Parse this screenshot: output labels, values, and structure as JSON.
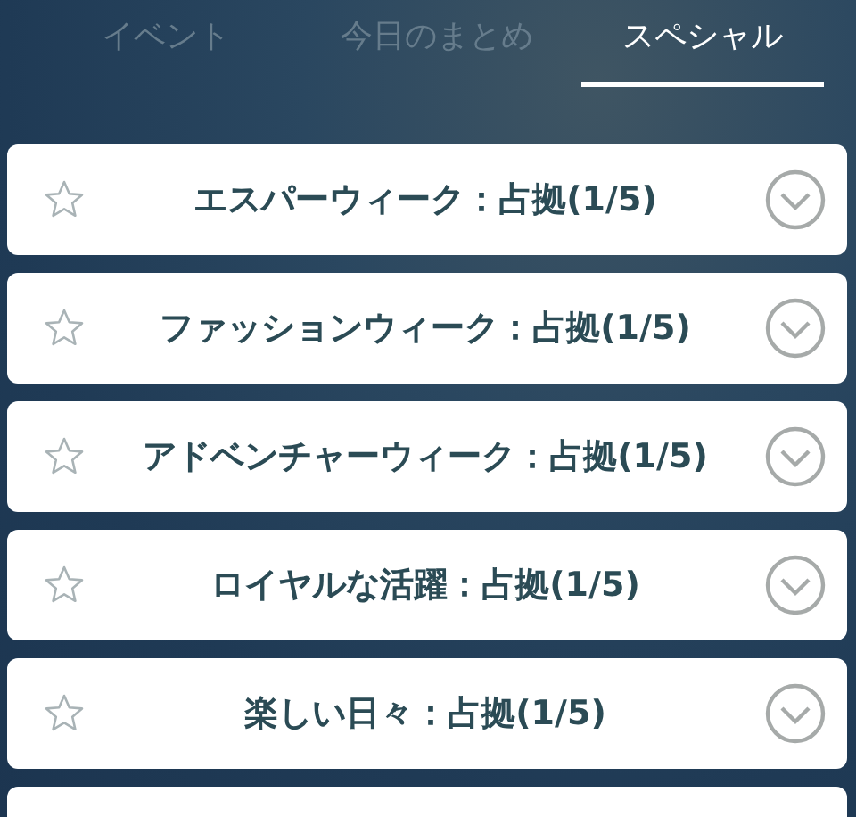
{
  "tabs": [
    {
      "label": "イベント",
      "selected": false
    },
    {
      "label": "今日のまとめ",
      "selected": false
    },
    {
      "label": "スペシャル",
      "selected": true
    }
  ],
  "quests": [
    {
      "title": "エスパーウィーク：占拠(1/5)",
      "starred": false
    },
    {
      "title": "ファッションウィーク：占拠(1/5)",
      "starred": false
    },
    {
      "title": "アドベンチャーウィーク：占拠(1/5)",
      "starred": false
    },
    {
      "title": "ロイヤルな活躍：占拠(1/5)",
      "starred": false
    },
    {
      "title": "楽しい日々：占拠(1/5)",
      "starred": false
    }
  ]
}
